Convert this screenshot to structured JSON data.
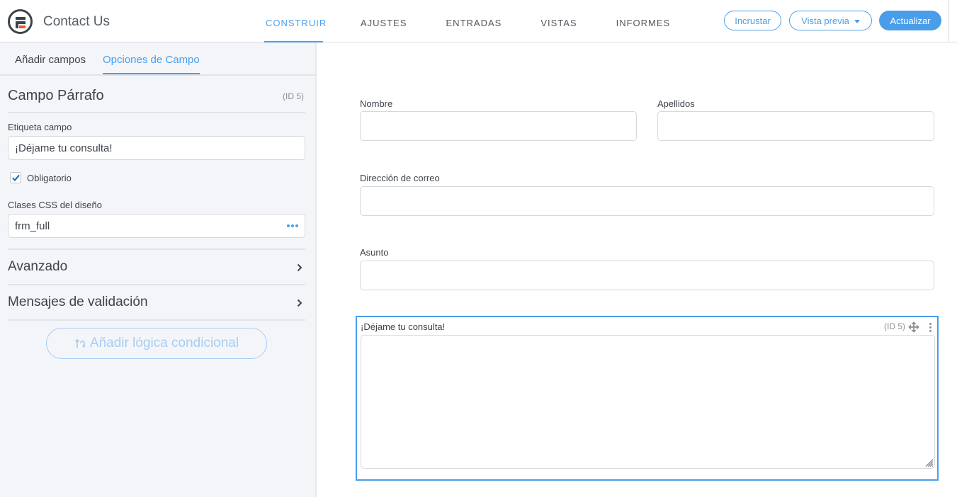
{
  "header": {
    "app_title": "Contact Us",
    "nav_tabs": [
      {
        "label": "CONSTRUIR",
        "active": true
      },
      {
        "label": "AJUSTES",
        "active": false
      },
      {
        "label": "ENTRADAS",
        "active": false
      },
      {
        "label": "VISTAS",
        "active": false
      },
      {
        "label": "INFORMES",
        "active": false
      }
    ],
    "embed_label": "Incrustar",
    "preview_label": "Vista previa",
    "update_label": "Actualizar"
  },
  "sidebar": {
    "tabs": [
      {
        "label": "Añadir campos",
        "active": false
      },
      {
        "label": "Opciones de Campo",
        "active": true
      }
    ],
    "field_heading": "Campo Párrafo",
    "field_id": "(ID 5)",
    "label_field": {
      "label": "Etiqueta campo",
      "value": "¡Déjame tu consulta!"
    },
    "required": {
      "label": "Obligatorio",
      "checked": true
    },
    "css_classes": {
      "label": "Clases CSS del diseño",
      "value": "frm_full"
    },
    "accordions": [
      {
        "label": "Avanzado"
      },
      {
        "label": "Mensajes de validación"
      }
    ],
    "conditional_logic_label": "Añadir lógica condicional"
  },
  "form": {
    "fields": [
      {
        "label": "Nombre",
        "value": ""
      },
      {
        "label": "Apellidos",
        "value": ""
      },
      {
        "label": "Dirección de correo",
        "value": ""
      },
      {
        "label": "Asunto",
        "value": ""
      }
    ],
    "selected_field": {
      "label": "¡Déjame tu consulta!",
      "id": "(ID 5)",
      "value": ""
    }
  },
  "colors": {
    "accent": "#4a9ee9",
    "logo_accent": "#f05a24",
    "sidebar_bg": "#f4f5f9"
  }
}
